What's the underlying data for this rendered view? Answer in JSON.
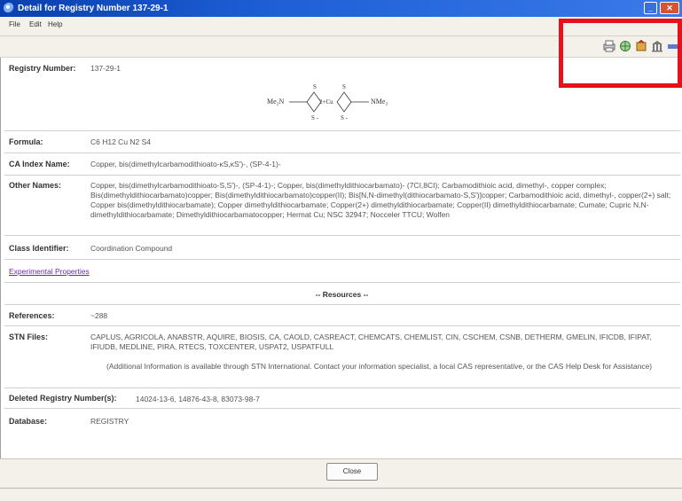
{
  "window": {
    "title": "Detail for Registry Number 137-29-1"
  },
  "menu": {
    "file": "File",
    "edit": "Edit",
    "help": "Help"
  },
  "toolbar": {
    "icons": [
      "print-icon",
      "network-icon",
      "tools-icon",
      "building-icon",
      "more-icon"
    ]
  },
  "record": {
    "registry_number_label": "Registry Number:",
    "registry_number": "137-29-1",
    "structure": {
      "left_group": "Me₂N",
      "right_group": "NMe₂",
      "center": "2+Cu",
      "s_top_left": "S",
      "s_top_right": "S",
      "s_bottom_left": "S -",
      "s_bottom_right": "S -"
    },
    "formula_label": "Formula:",
    "formula": "C6 H12 Cu N2 S4",
    "ca_index_name_label": "CA Index Name:",
    "ca_index_name": "Copper, bis(dimethylcarbamodithioato-κS,κS')-, (SP-4-1)-",
    "other_names_label": "Other Names:",
    "other_names": "Copper, bis(dimethylcarbamodithioato-S,S')-, (SP-4-1)-; Copper, bis(dimethyldithiocarbamato)- (7CI,8CI); Carbamodithioic acid, dimethyl-, copper complex; Bis(dimethyldithiocarbamato)copper; Bis(dimethyldithiocarbamato)copper(II); Bis[N,N-dimethyl(dithiocarbamato-S,S')]copper; Carbamodithioic acid, dimethyl-, copper(2+) salt; Copper bis(dimethyldithiocarbamate); Copper dimethyldithiocarbamate; Copper(2+) dimethyldithiocarbamate; Copper(II) dimethyldithiocarbamate; Cumate; Cupric N,N-dimethyldithiocarbamate; Dimethyldithiocarbamatocopper; Hermat Cu; NSC 32947; Nocceler TTCU; Wolfen",
    "class_identifier_label": "Class Identifier:",
    "class_identifier": "Coordination Compound",
    "experimental_properties_link": "Experimental Properties",
    "resources_heading": "-- Resources --",
    "references_label": "References:",
    "references": "~288",
    "stn_files_label": "STN Files:",
    "stn_files": "CAPLUS, AGRICOLA, ANABSTR, AQUIRE, BIOSIS, CA, CAOLD, CASREACT, CHEMCATS, CHEMLIST, CIN, CSCHEM, CSNB, DETHERM, GMELIN, IFICDB, IFIPAT, IFIUDB, MEDLINE, PIRA, RTECS, TOXCENTER, USPAT2, USPATFULL",
    "additional_info": "(Additional Information is available through STN International.  Contact your information specialist, a local CAS representative, or the CAS Help Desk for Assistance)",
    "deleted_label": "Deleted Registry Number(s):",
    "deleted_numbers": "14024-13-6, 14876-43-8, 83073-98-7",
    "database_label": "Database:",
    "database": "REGISTRY"
  },
  "footer": {
    "close_label": "Close"
  },
  "colors": {
    "titlebar": "#1e5fd6",
    "highlight": "#e8101a",
    "link": "#6a2bb0"
  }
}
